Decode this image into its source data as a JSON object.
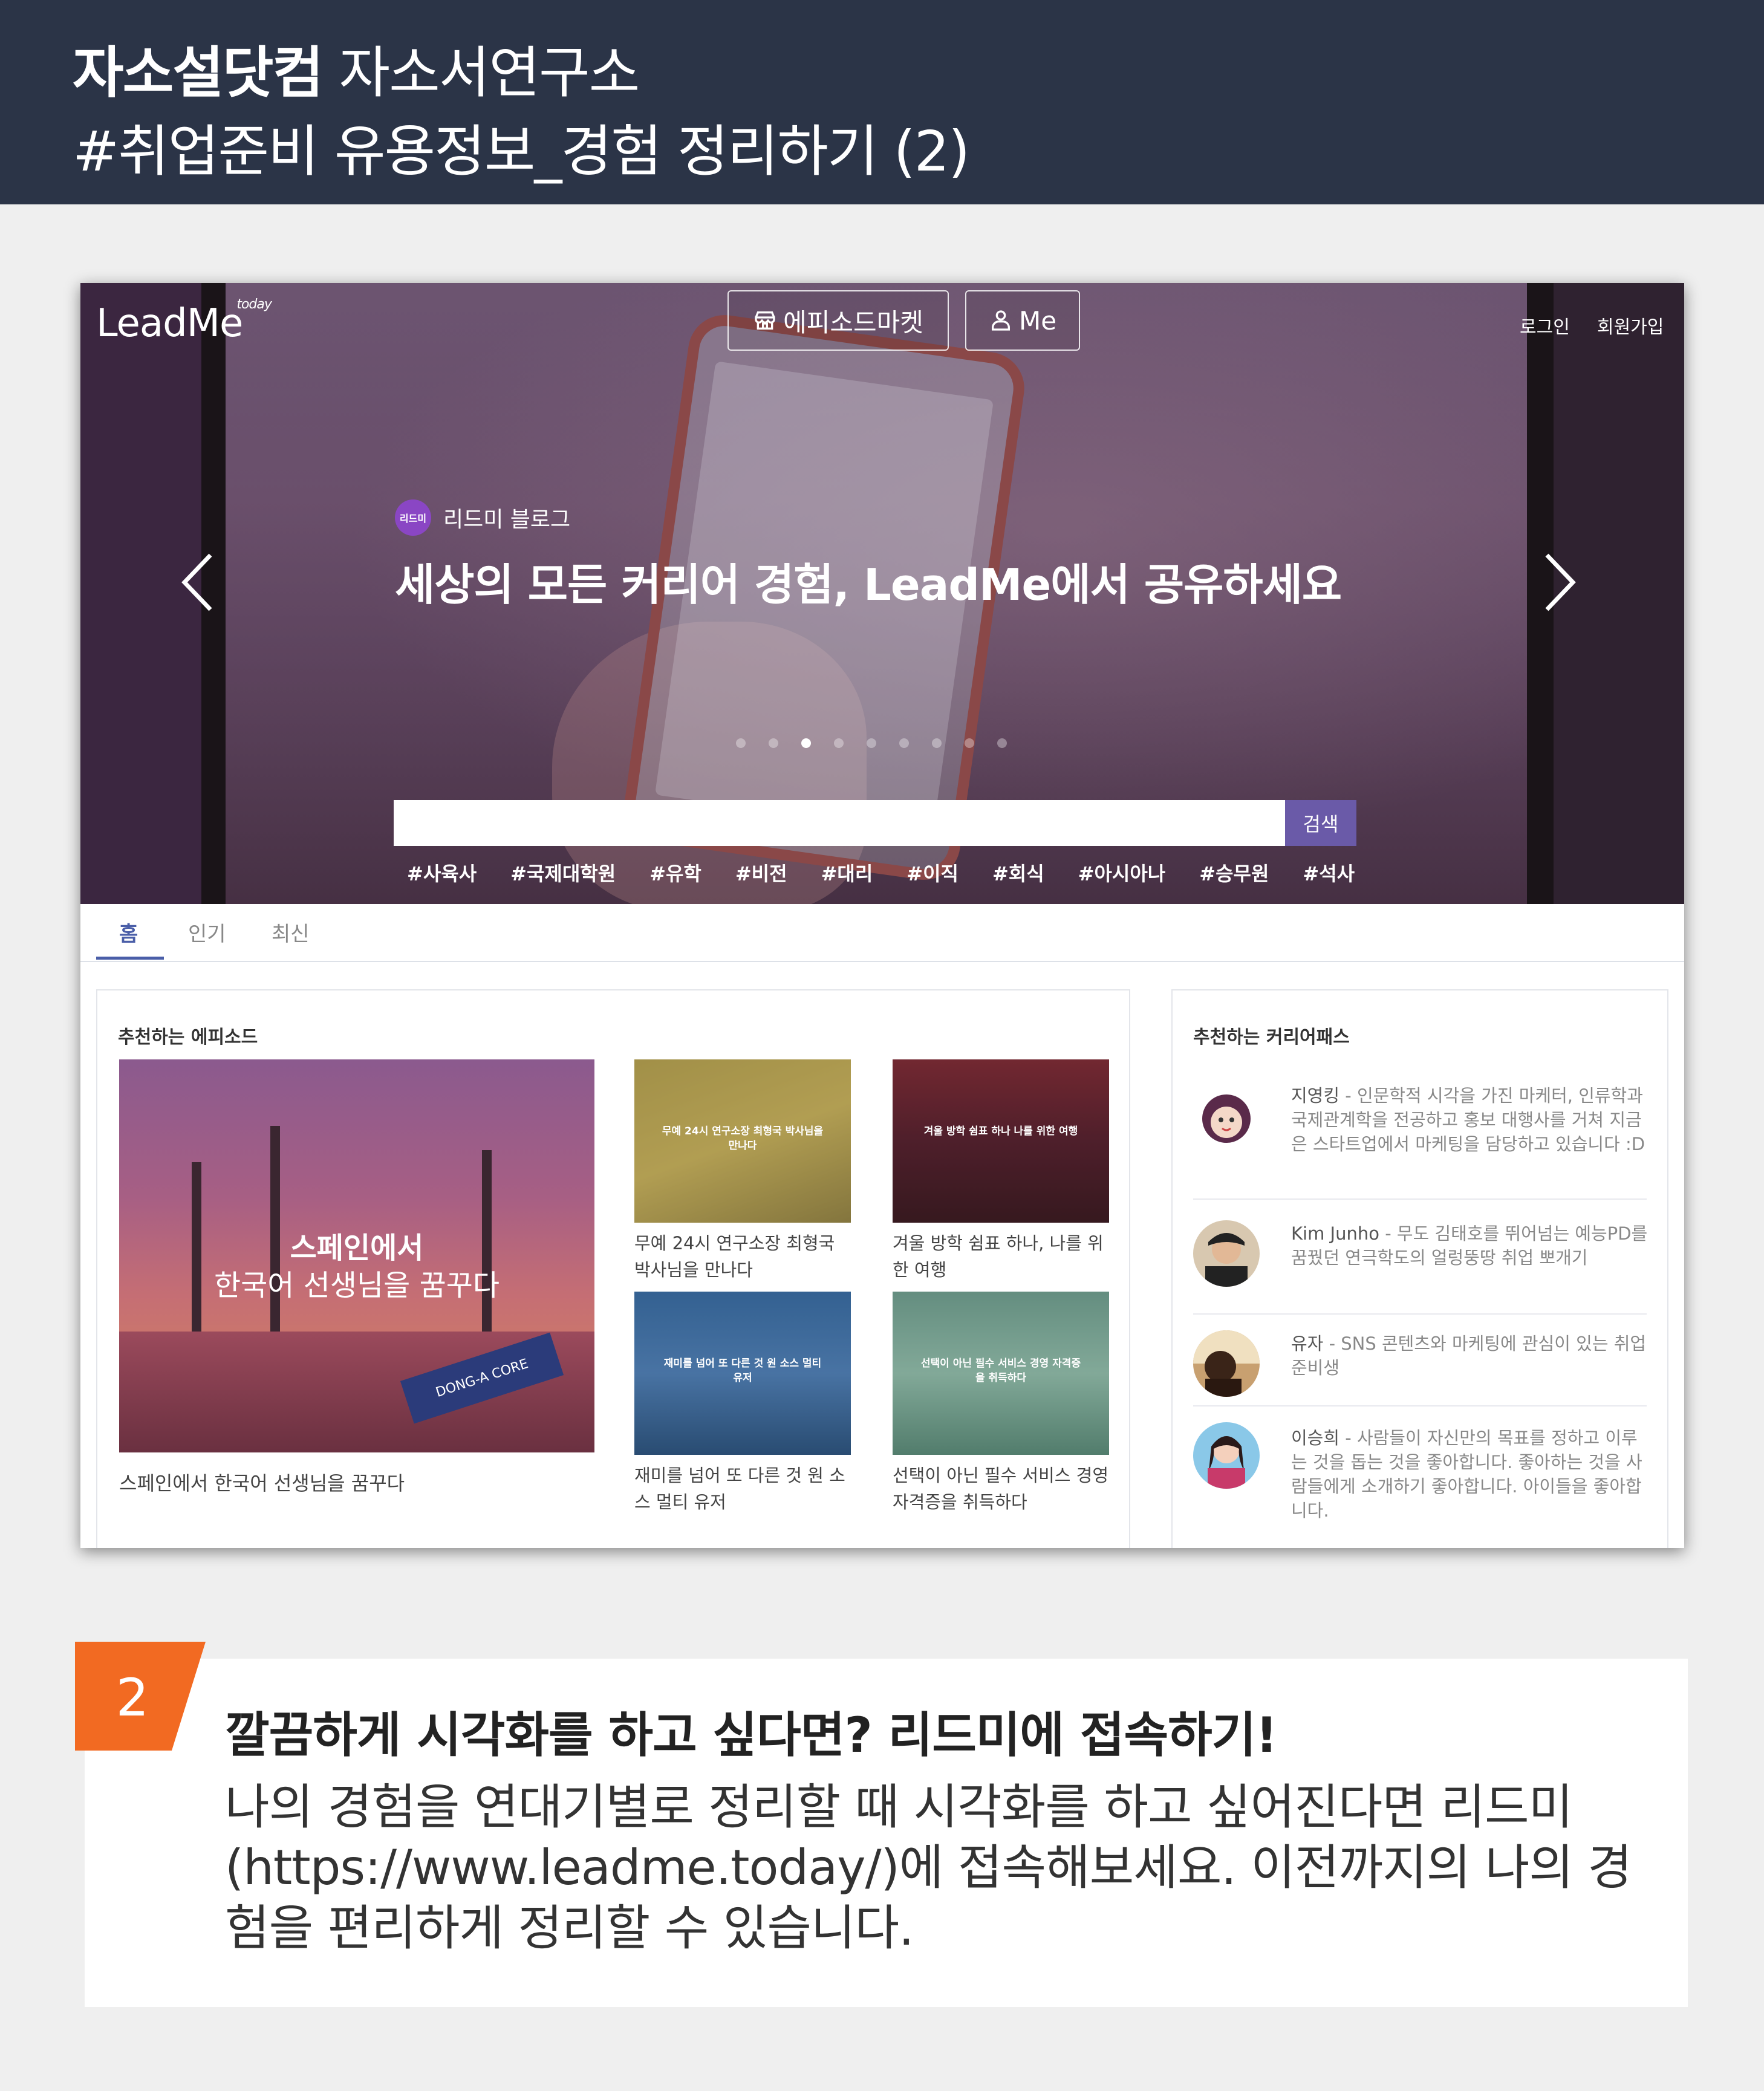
{
  "header": {
    "brand": "자소설닷컴",
    "section": "자소서연구소",
    "subtitle": "#취업준비 유용정보_경험 정리하기 (2)"
  },
  "site": {
    "logo": "LeadMe",
    "logo_sup": "today",
    "market_button": "에피소드마켓",
    "me_button": "Me",
    "login": "로그인",
    "signup": "회원가입",
    "blog_badge": "리드미",
    "blog_label": "리드미 블로그",
    "headline": "세상의 모든 커리어 경험, LeadMe에서 공유하세요",
    "carousel": {
      "total": 9,
      "active": 3
    },
    "search_placeholder": "",
    "search_button": "검색",
    "tags": [
      "#사육사",
      "#국제대학원",
      "#유학",
      "#비전",
      "#대리",
      "#이직",
      "#회식",
      "#아시아나",
      "#승무원",
      "#석사"
    ]
  },
  "tabs": [
    "홈",
    "인기",
    "최신"
  ],
  "episodes": {
    "title": "추천하는 에피소드",
    "feature": {
      "overlay_line1": "스페인에서",
      "overlay_line2": "한국어 선생님을 꿈꾸다",
      "scarf": "DONG-A CORE",
      "caption": "스페인에서 한국어 선생님을 꿈꾸다"
    },
    "items": [
      {
        "overlay": "무예 24시 연구소장 최형국 박사님을 만나다",
        "caption": "무예 24시 연구소장 최형국 박사님을 만나다"
      },
      {
        "overlay": "겨울 방학 쉼표 하나 나를 위한 여행",
        "caption": "겨울 방학 쉼표 하나, 나를 위한 여행"
      },
      {
        "overlay": "재미를 넘어 또 다른 것 원 소스 멀티 유저",
        "caption": "재미를 넘어 또 다른 것 원 소스 멀티 유저"
      },
      {
        "overlay": "선택이 아닌 필수 서비스 경영 자격증을 취득하다",
        "caption": "선택이 아닌 필수 서비스 경영 자격증을 취득하다"
      }
    ]
  },
  "careers": {
    "title": "추천하는 커리어패스",
    "items": [
      {
        "name": "지영킹",
        "desc": " - 인문학적 시각을 가진 마케터, 인류학과 국제관계학을 전공하고 홍보 대행사를 거쳐 지금은 스타트업에서 마케팅을 담당하고 있습니다 :D"
      },
      {
        "name": "Kim Junho",
        "desc": " - 무도 김태호를 뛰어넘는 예능PD를 꿈꿨던 연극학도의 얼렁뚱땅 취업 뽀개기"
      },
      {
        "name": "유자",
        "desc": " - SNS 콘텐츠와 마케팅에 관심이 있는 취업준비생"
      },
      {
        "name": "이승희",
        "desc": " - 사람들이 자신만의 목표를 정하고 이루는 것을 돕는 것을 좋아합니다. 좋아하는 것을 사람들에게 소개하기 좋아합니다. 아이들을 좋아합니다."
      }
    ]
  },
  "callout": {
    "number": "2",
    "title": "깔끔하게 시각화를 하고 싶다면? 리드미에 접속하기!",
    "body": "나의 경험을 연대기별로 정리할 때 시각화를 하고 싶어진다면 리드미(https://www.leadme.today/)에 접속해보세요. 이전까지의 나의 경험을 편리하게 정리할 수 있습니다.",
    "accent_color": "#f26a22"
  },
  "colors": {
    "header_bg": "#2b3447",
    "tab_active": "#4a5ea8",
    "search_btn": "#6a5aa8"
  }
}
